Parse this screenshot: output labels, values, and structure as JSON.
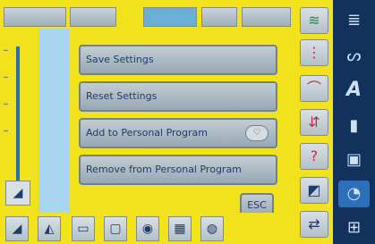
{
  "dialog": {
    "items": [
      {
        "label": "Save Settings"
      },
      {
        "label": "Reset Settings"
      },
      {
        "label": "Add to Personal Program"
      },
      {
        "label": "Remove from Personal Program"
      }
    ],
    "esc_label": "ESC"
  },
  "topbar": {
    "seg1": "",
    "seg2": "",
    "seg3": "",
    "seg4": "",
    "seg5": ""
  },
  "colors": {
    "screen_bg": "#f2e21c",
    "sidebar_bg": "#12315c",
    "button_text": "#1f3c6e",
    "stitch_area": "#a7d6ee"
  },
  "icons": {
    "right_column": [
      "stitch-width-icon",
      "needle-position-icon",
      "stitch-length-icon",
      "balance-icon",
      "help-icon",
      "pattern-end-icon",
      "mirror-icon"
    ],
    "sidebar": [
      "personal-program-icon",
      "stitch-select-icon",
      "alphabet-icon",
      "buttonhole-icon",
      "quilt-icon",
      "embroidery-icon",
      "setup-icon"
    ],
    "bottom": [
      "presser-foot-icon",
      "feed-dog-icon",
      "tension-icon",
      "needle-stop-icon",
      "memory-icon",
      "speed-icon",
      "bobbin-icon"
    ]
  }
}
